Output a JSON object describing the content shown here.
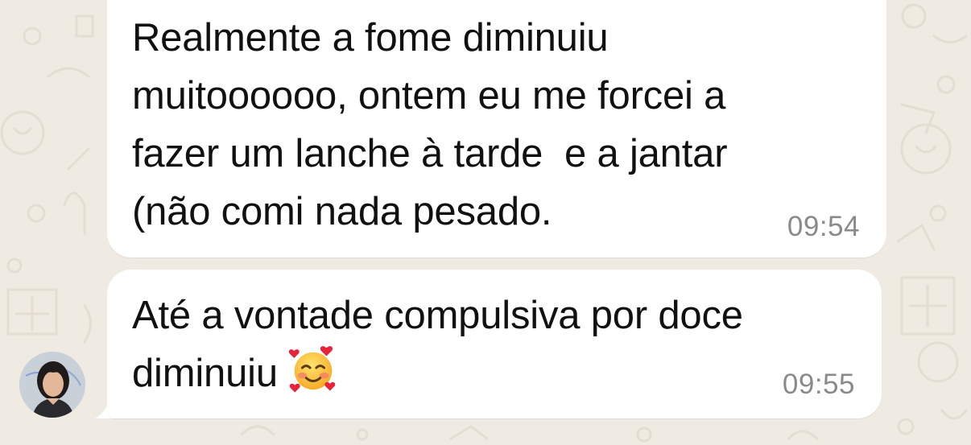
{
  "chat": {
    "wallpaper_color": "#efeae2",
    "bubble_color": "#ffffff",
    "messages": [
      {
        "lines": [
          "Realmente a fome diminuiu",
          "muitoooooo, ontem eu me forcei a",
          "fazer um lanche à tarde  e a jantar",
          "(não comi nada pesado."
        ],
        "time": "09:54"
      },
      {
        "lines": [
          "Até a vontade compulsiva por doce",
          "diminuiu"
        ],
        "emoji": "smiling-face-with-hearts",
        "time": "09:55"
      }
    ]
  }
}
